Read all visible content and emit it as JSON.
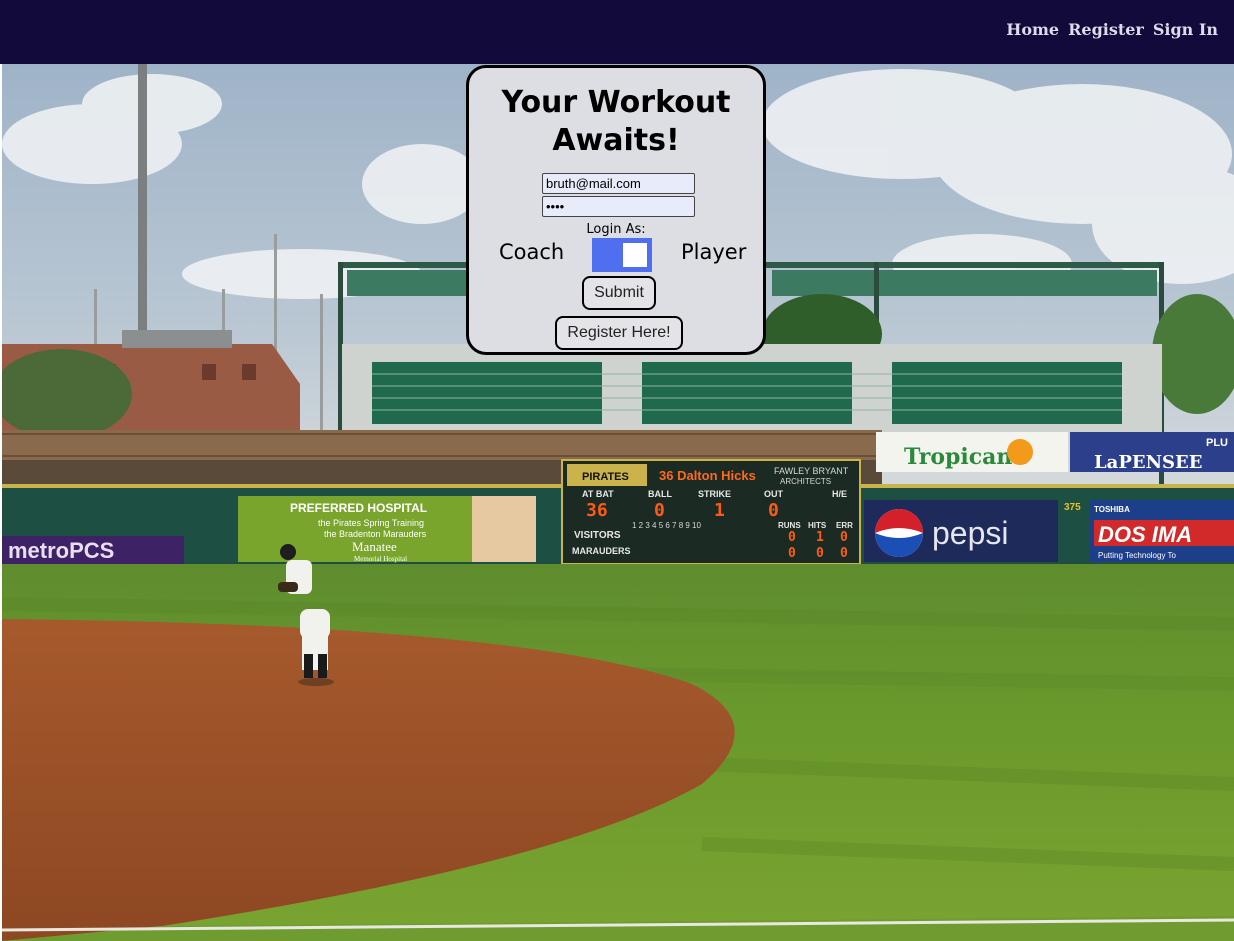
{
  "nav": {
    "links": [
      {
        "label": "Home"
      },
      {
        "label": "Register"
      },
      {
        "label": "Sign In"
      }
    ]
  },
  "login": {
    "title": "Your Workout Awaits!",
    "email_value": "bruth@mail.com",
    "password_value": "abcd",
    "login_as_label": "Login As:",
    "role_left": "Coach",
    "role_right": "Player",
    "submit_label": "Submit",
    "register_label": "Register Here!"
  },
  "background": {
    "ads": {
      "metro": "metroPCS",
      "hospital_title": "PREFERRED HOSPITAL",
      "hospital_line1": "the Pirates Spring Training",
      "hospital_line2": "the Bradenton Marauders",
      "hospital_brand": "Manatee",
      "hospital_sub": "Memorial Hospital",
      "tropicana": "Tropicana",
      "lapensee": "LaPENSEE",
      "lapensee_tail": "PLU",
      "pepsi": "pepsi",
      "toshiba": "TOSHIBA",
      "dos": "DOS IMA",
      "dos_tag": "Putting Technology To",
      "fawley_1": "FAWLEY BRYANT",
      "fawley_2": "ARCHITECTS",
      "distance": "375"
    },
    "scoreboard": {
      "team_logo": "PIRATES",
      "batter": "36 Dalton Hicks",
      "at_bat_label": "AT BAT",
      "ball_label": "BALL",
      "strike_label": "STRIKE",
      "out_label": "OUT",
      "he_label": "H/E",
      "at_bat": "36",
      "ball": "0",
      "strike": "1",
      "out": "0",
      "innings": "1 2 3 4 5 6 7 8 9 10",
      "runs_label": "RUNS",
      "hits_label": "HITS",
      "err_label": "ERR",
      "visitors_label": "VISITORS",
      "home_label": "MARAUDERS",
      "visitors_runs": "0",
      "visitors_hits": "1",
      "visitors_err": "0",
      "home_runs": "0",
      "home_hits": "0",
      "home_err": "0"
    }
  },
  "colors": {
    "topbar": "#110a3a",
    "card_bg": "#dcdee4",
    "toggle": "#4f6ef0"
  }
}
